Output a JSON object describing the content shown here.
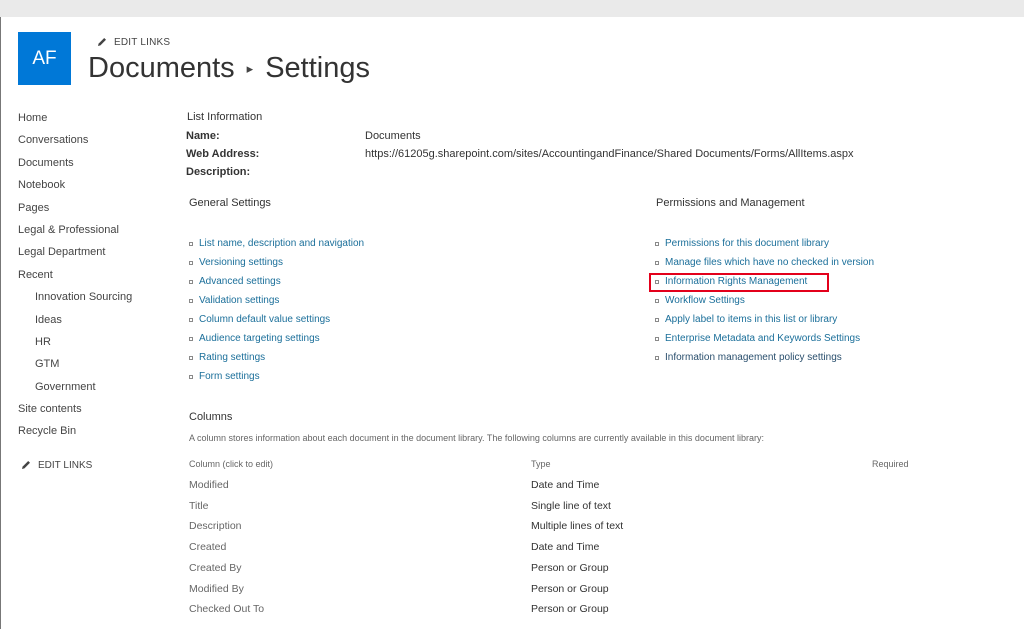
{
  "header": {
    "tile_text": "AF",
    "edit_links": "EDIT LINKS",
    "title_part1": "Documents",
    "title_separator": "▸",
    "title_part2": "Settings"
  },
  "nav": {
    "items": [
      {
        "label": "Home",
        "sub": false
      },
      {
        "label": "Conversations",
        "sub": false
      },
      {
        "label": "Documents",
        "sub": false
      },
      {
        "label": "Notebook",
        "sub": false
      },
      {
        "label": "Pages",
        "sub": false
      },
      {
        "label": "Legal & Professional",
        "sub": false
      },
      {
        "label": "Legal Department",
        "sub": false
      },
      {
        "label": "Recent",
        "sub": false
      },
      {
        "label": "Innovation Sourcing",
        "sub": true
      },
      {
        "label": "Ideas",
        "sub": true
      },
      {
        "label": "HR",
        "sub": true
      },
      {
        "label": "GTM",
        "sub": true
      },
      {
        "label": "Government",
        "sub": true
      },
      {
        "label": "Site contents",
        "sub": false
      },
      {
        "label": "Recycle Bin",
        "sub": false
      }
    ],
    "edit_links": "EDIT LINKS"
  },
  "list_info": {
    "heading": "List Information",
    "name_label": "Name:",
    "name_value": "Documents",
    "web_label": "Web Address:",
    "web_value": "https://61205g.sharepoint.com/sites/AccountingandFinance/Shared Documents/Forms/AllItems.aspx",
    "desc_label": "Description:"
  },
  "general": {
    "heading": "General Settings",
    "links": [
      "List name, description and navigation",
      "Versioning settings",
      "Advanced settings",
      "Validation settings",
      "Column default value settings",
      "Audience targeting settings",
      "Rating settings",
      "Form settings"
    ]
  },
  "permissions": {
    "heading": "Permissions and Management",
    "links": [
      "Permissions for this document library",
      "Manage files which have no checked in version",
      "Information Rights Management",
      "Workflow Settings",
      "Apply label to items in this list or library",
      "Enterprise Metadata and Keywords Settings",
      "Information management policy settings"
    ]
  },
  "columns": {
    "heading": "Columns",
    "description": "A column stores information about each document in the document library. The following columns are currently available in this document library:",
    "headers": {
      "column": "Column (click to edit)",
      "type": "Type",
      "required": "Required"
    },
    "rows": [
      {
        "name": "Modified",
        "type": "Date and Time"
      },
      {
        "name": "Title",
        "type": "Single line of text"
      },
      {
        "name": "Description",
        "type": "Multiple lines of text"
      },
      {
        "name": "Created",
        "type": "Date and Time"
      },
      {
        "name": "Created By",
        "type": "Person or Group"
      },
      {
        "name": "Modified By",
        "type": "Person or Group"
      },
      {
        "name": "Checked Out To",
        "type": "Person or Group"
      }
    ]
  },
  "colors": {
    "accent": "#0078d7",
    "link": "#1b6f9a",
    "highlight": "#e3001b"
  }
}
